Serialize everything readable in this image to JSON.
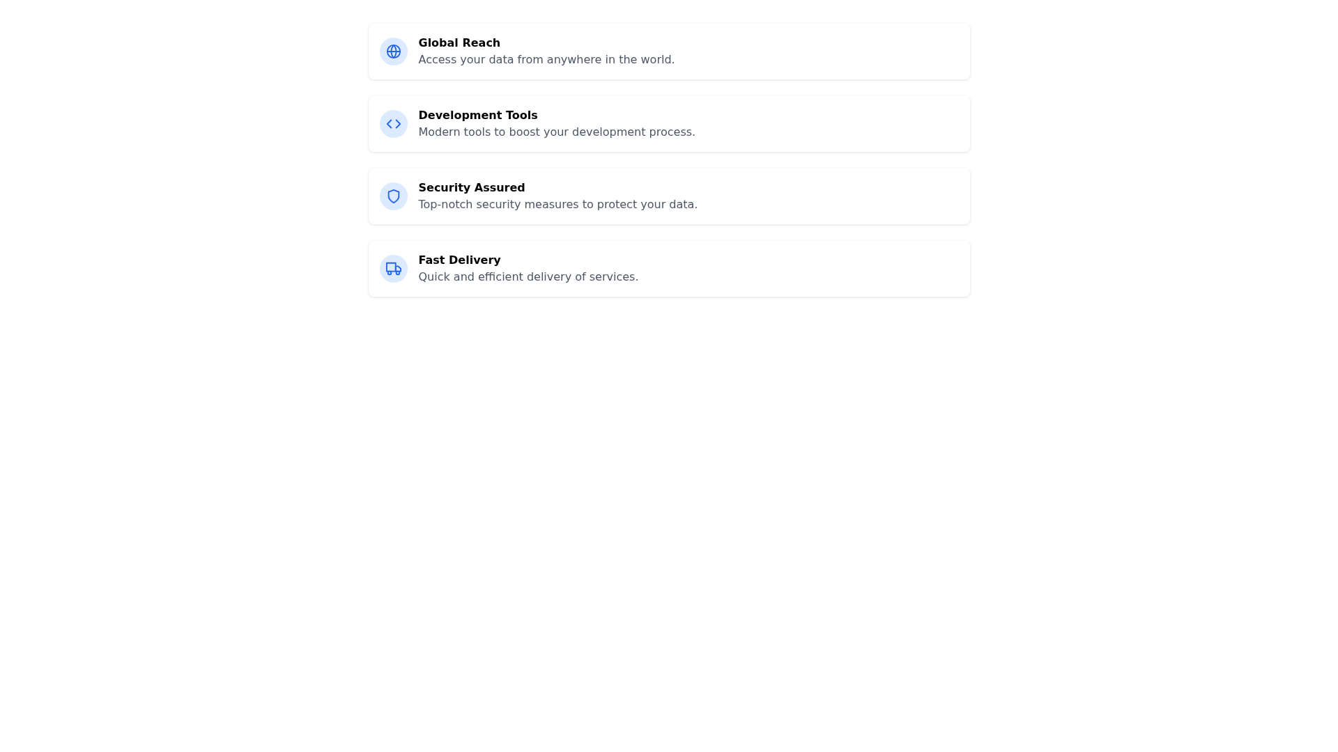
{
  "features": [
    {
      "kind": "globe",
      "title": "Global Reach",
      "description": "Access your data from anywhere in the world."
    },
    {
      "kind": "code",
      "title": "Development Tools",
      "description": "Modern tools to boost your development process."
    },
    {
      "kind": "shield",
      "title": "Security Assured",
      "description": "Top-notch security measures to protect your data."
    },
    {
      "kind": "truck",
      "title": "Fast Delivery",
      "description": "Quick and efficient delivery of services."
    }
  ]
}
